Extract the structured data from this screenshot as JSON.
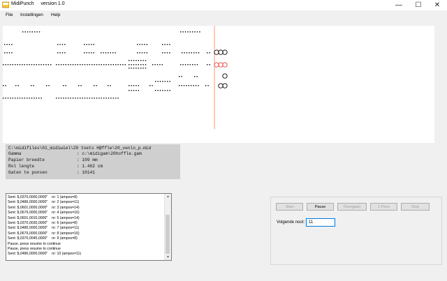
{
  "window": {
    "app_name": "MidiPunch",
    "version": "version 1.0",
    "minimize_glyph": "—",
    "maximize_glyph": "☐",
    "close_glyph": "✕"
  },
  "menu": {
    "items": [
      "File",
      "Instellingen",
      "Help"
    ]
  },
  "info": {
    "path": "C:\\midifiles\\01_midiwiel\\20 toets H@ffle\\20_venlo_p.mid",
    "rows": [
      {
        "label": "Gamma",
        "value": ": c:\\midigam\\20hoffle.gam"
      },
      {
        "label": "Papier breedte",
        "value": ": 109 mm"
      },
      {
        "label": "Rol lengte",
        "value": ": 1.462 cm"
      },
      {
        "label": "Gaten te ponsen",
        "value": ": 10141"
      }
    ]
  },
  "log": {
    "lines": [
      "Sent: $,0370,0000,0000\"    nr: 1 (ampos=8)",
      "Sent: $,0486,0000,0000\"    nr: 2 (ampos=11)",
      "Sent: $,0601,0000,0000\"    nr: 3 (ampos=14)",
      "Sent: $,0679,0000,0000\"    nr: 4 (ampos=16)",
      "Sent: $,0601,0015,0000\"    nr: 5 (ampos=14)",
      "Sent: $,0370,0030,0000\"    nr: 6 (ampos=8)",
      "Sent: $,0486,0000,0000\"    nr: 7 (ampos=11)",
      "Sent: $,0679,0000,0000\"    nr: 8 (ampos=16)",
      "Sent: $,0370,0045,0000\"    nr: 9 (ampos=8)",
      "Pause, press resume to continue",
      "Pause, press resume to continue",
      "Sent: $,0486,0000,0000\"    nr: 10 (ampos=11)"
    ]
  },
  "controls": {
    "start_label": "Start",
    "pause_label": "Pause",
    "doorgaan_label": "Doorgaan",
    "eenponsje_label": "1 Pons",
    "stop_label": "Stop",
    "volgende_noot_label": "Volgende noot:",
    "volgende_noot_value": "11"
  },
  "colors": {
    "playhead": "#e8a080",
    "hole_ring_red": "#e04040",
    "accent_focus": "#0078d7"
  }
}
